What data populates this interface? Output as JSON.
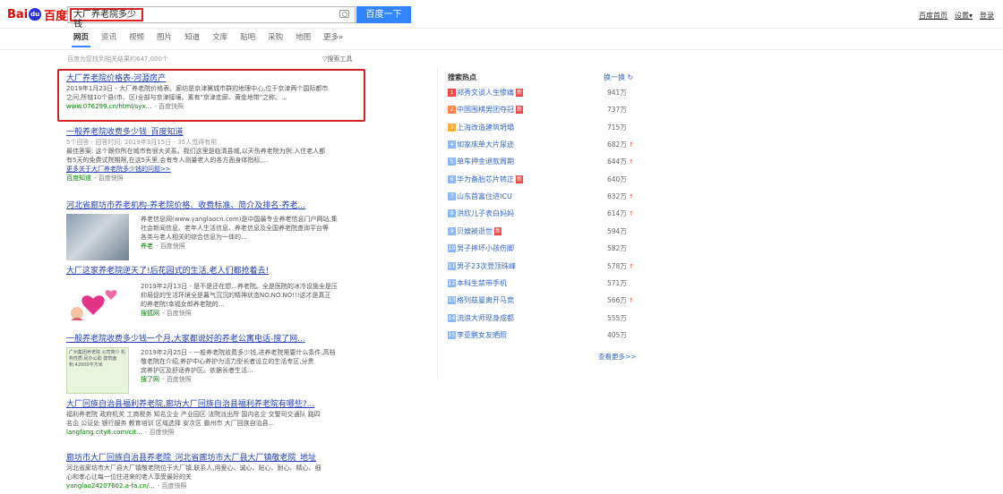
{
  "header": {
    "logo_text": "Bai",
    "logo_cn": "百度",
    "query": "大厂养老院多少钱",
    "search_button": "百度一下",
    "top_links": [
      "百度首页",
      "设置▾",
      "登录"
    ]
  },
  "tabs": [
    "网页",
    "资讯",
    "视频",
    "图片",
    "知道",
    "文库",
    "贴吧",
    "采购",
    "地图",
    "更多»"
  ],
  "result_count": "百度为您找到相关结果约647,000个",
  "tools": "▽搜索工具",
  "results": [
    {
      "title": "大厂养老院价格表-河源房产",
      "body1": "2019年1月23日 - 大厂养老院价格表。廊坊是京津冀城市群的地理中心,位于京津两个国际都市",
      "body2": "之间,所辖10个县(市、区)全部与京津接壤。素有\"京津走廊、黄金地带\"之称。...",
      "url": "www.076299.cn/html/syx...",
      "snap": "- 百度快照"
    },
    {
      "title": "一般养老院收费多少钱_百度知道",
      "meta": "5个回答 - 回答时间: 2019年3月15日 - 35人觉得有用",
      "body1": "最佳答案: 这个跟你所在城市有很大关系。我们这里是临清县城,以天伤养老院为例:入住老人都",
      "body2": "有5天的免费试院期限,在这5天里,会有专人测量老人的各方面身体指标,...",
      "more": "更多关于大厂养老院多少钱的问题>>",
      "url": "百度知道",
      "snap": "- 百度快照"
    },
    {
      "title": "河北省廊坊市养老机构-养老院价格、收费标准、简介及排名-养老...",
      "body1": "养老信息网(www.yanglaocn.com)是中国最专业养老信息门户网站,集",
      "body2": "社会新闻信息、老年人生活信息、养老信息及全国养老院查询平台等",
      "body3": "各类与老人相关的综合信息为一体的...",
      "url": "养老",
      "snap": "- 百度快照"
    },
    {
      "title": "大厂这家养老院逆天了!后花园式的生活,老人们都抢着去!",
      "body1": "2019年2月13日 - 是不是还在想...养老院。全是医院的冰冷设施全是压",
      "body2": "抑局促的生活环境全是暮气沉沉的精神状态NO.NO.NO!!!这才是真正",
      "body3": "的养老院!幸福女郎养老院的...",
      "url": "搜狐网",
      "snap": "- 百度快照"
    },
    {
      "title": "一般养老院收费多少钱一个月,大家都说好的养老公寓电话-搜了网...",
      "body1": "2019年2月25日 - 一般养老院收费多少钱,进养老院需要什么条件,高档",
      "body2": "敬老院在介绍,养护中心养护为活力型长者设立的生活专区,分贵",
      "body3": "宾养护区及舒适养护区。依据长者生活...",
      "url": "搜了网",
      "snap": "- 百度快照"
    },
    {
      "title": "大厂回族自治县福利养老院,廊坊大厂回族自治县福利养老院有哪些?...",
      "body1": "福利养老院 政府机关 工商税务 知名企业 产业园区 法院派出所 国内名企 交警司交通队 路四",
      "body2": "名企 公证处 银行服务 教育培训 区域选择 安次区 霸州市 大厂回族自治县...",
      "url": "langfang.city8.com/cit...",
      "snap": "- 百度快照"
    },
    {
      "title": "廊坊市大厂回族自治县养老院_河北省廊坊市大厂县大厂镇敬老院_地址",
      "body1": "河北省廊坊市大厂县大厂镇敬老院位于大厂镇,联系人,用爱心、诚心、贴心、耐心、精心、细",
      "body2": "心和孝心让每一位住进来的老人享受最好的关",
      "url": "yanglao24207602.a-fa.cn/...",
      "snap": "- 百度快照"
    }
  ],
  "thumb_text": "广州集团养老院 公司简介 机构性质:民办公助 建筑面积:42000平方米",
  "hot": {
    "title": "搜索热点",
    "refresh": "换一换",
    "more": "查看更多>>",
    "items": [
      {
        "n": "1",
        "name": "郑秀文谈人生惨痛",
        "new": "新",
        "val": "941万",
        "up": ""
      },
      {
        "n": "2",
        "name": "中国围棋男团夺冠",
        "new": "新",
        "val": "737万",
        "up": ""
      },
      {
        "n": "3",
        "name": "上海改造建筑坍塌",
        "new": "",
        "val": "715万",
        "up": ""
      },
      {
        "n": "4",
        "name": "如家床单大片尿迹",
        "new": "",
        "val": "682万",
        "up": "↑"
      },
      {
        "n": "5",
        "name": "单车押金退款周期",
        "new": "",
        "val": "644万",
        "up": "↑"
      },
      {
        "n": "6",
        "name": "华为备胎芯片转正",
        "new": "新",
        "val": "640万",
        "up": ""
      },
      {
        "n": "7",
        "name": "山东首富住进ICU",
        "new": "",
        "val": "632万",
        "up": "↑"
      },
      {
        "n": "8",
        "name": "洪欣儿子表白妈妈",
        "new": "",
        "val": "614万",
        "up": "↑"
      },
      {
        "n": "9",
        "name": "贝嫂被逝世",
        "new": "新",
        "val": "594万",
        "up": ""
      },
      {
        "n": "10",
        "name": "男子摔坏小孩伤脚",
        "new": "",
        "val": "582万",
        "up": ""
      },
      {
        "n": "11",
        "name": "男子23次登顶珠峰",
        "new": "",
        "val": "578万",
        "up": "↑"
      },
      {
        "n": "12",
        "name": "本科生禁带手机",
        "new": "",
        "val": "571万",
        "up": ""
      },
      {
        "n": "13",
        "name": "格列兹曼离开马竞",
        "new": "",
        "val": "566万",
        "up": "↑"
      },
      {
        "n": "14",
        "name": "流浪大师现身成都",
        "new": "",
        "val": "555万",
        "up": ""
      },
      {
        "n": "15",
        "name": "李亚鹏女友晒照",
        "new": "",
        "val": "405万",
        "up": ""
      }
    ]
  }
}
